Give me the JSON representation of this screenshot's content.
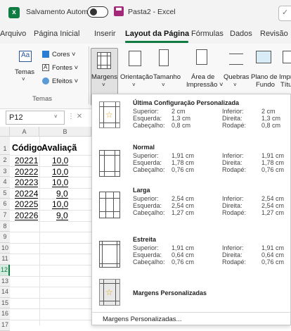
{
  "titlebar": {
    "autosave_label": "Salvamento Automático",
    "doc_title": "Pasta2 - Excel",
    "search_hint": "✓"
  },
  "menubar": {
    "tabs": [
      "Arquivo",
      "Página Inicial",
      "Inserir",
      "Layout da Página",
      "Fórmulas",
      "Dados",
      "Revisão"
    ],
    "active_tab": "Layout da Página",
    "accent": "#107c41"
  },
  "ribbon": {
    "themes_group": {
      "temas": "Temas",
      "cores": "Cores ˅",
      "fontes": "Fontes ˅",
      "efeitos": "Efeitos ˅",
      "group_label": "Temas"
    },
    "buttons": {
      "margens": "Margens",
      "orientacao": "Orientação",
      "tamanho": "Tamanho",
      "area_impressao_1": "Área de",
      "area_impressao_2": "Impressão ˅",
      "quebras": "Quebras",
      "plano_fundo_1": "Plano de",
      "plano_fundo_2": "Fundo",
      "imprimir_1": "Impr",
      "imprimir_2": "Títu"
    }
  },
  "namebox": {
    "value": "P12"
  },
  "sheet": {
    "columns": [
      "A",
      "B"
    ],
    "row_numbers": [
      "1",
      "2",
      "3",
      "4",
      "5",
      "6",
      "7",
      "8",
      "9",
      "10",
      "11",
      "12",
      "13",
      "14",
      "15",
      "16",
      "17"
    ],
    "selected_row": "12",
    "header": {
      "codigo": "Código",
      "avaliacao": "Avaliaçã"
    },
    "rows": [
      {
        "codigo": "20221",
        "nota": "10,0"
      },
      {
        "codigo": "20222",
        "nota": "10,0"
      },
      {
        "codigo": "20223",
        "nota": "10,0"
      },
      {
        "codigo": "20224",
        "nota": "9,0"
      },
      {
        "codigo": "20225",
        "nota": "10,0"
      },
      {
        "codigo": "20226",
        "nota": "9,0"
      }
    ]
  },
  "margins_menu": {
    "options": [
      {
        "title": "Última Configuração Personalizada",
        "superior": "2 cm",
        "inferior": "2 cm",
        "esquerda": "1,3 cm",
        "direita": "1,3 cm",
        "cabecalho": "0,8 cm",
        "rodape": "0,8 cm"
      },
      {
        "title": "Normal",
        "superior": "1,91 cm",
        "inferior": "1,91 cm",
        "esquerda": "1,78 cm",
        "direita": "1,78 cm",
        "cabecalho": "0,76 cm",
        "rodape": "0,76 cm"
      },
      {
        "title": "Larga",
        "superior": "2,54 cm",
        "inferior": "2,54 cm",
        "esquerda": "2,54 cm",
        "direita": "2,54 cm",
        "cabecalho": "1,27 cm",
        "rodape": "1,27 cm"
      },
      {
        "title": "Estreita",
        "superior": "1,91 cm",
        "inferior": "1,91 cm",
        "esquerda": "0,64 cm",
        "direita": "0,64 cm",
        "cabecalho": "0,76 cm",
        "rodape": "0,76 cm"
      }
    ],
    "labels": {
      "superior": "Superior:",
      "inferior": "Inferior:",
      "esquerda": "Esquerda:",
      "direita": "Direita:",
      "cabecalho": "Cabeçalho:",
      "rodape": "Rodapé:"
    },
    "custom_option": "Margens Personalizadas",
    "footer_link": "Margens Personalizadas..."
  }
}
